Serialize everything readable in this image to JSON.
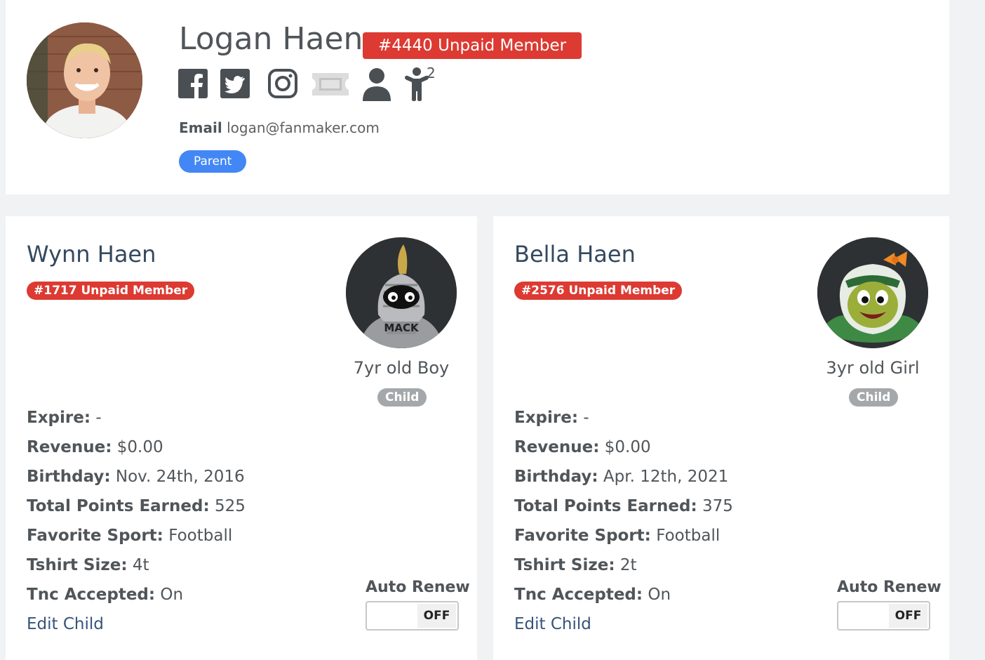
{
  "parent": {
    "name": "Logan Haen",
    "member_badge": "#4440 Unpaid Member",
    "kid_count": "2",
    "email_label": "Email",
    "email": "logan@fanmaker.com",
    "role": "Parent",
    "icons": [
      "facebook-icon",
      "twitter-icon",
      "instagram-icon",
      "ticket-icon",
      "person-icon",
      "child-icon"
    ]
  },
  "children": [
    {
      "name": "Wynn Haen",
      "member_badge": "#1717 Unpaid Member",
      "age": "7yr old Boy",
      "role": "Child",
      "fields": {
        "expire_label": "Expire:",
        "expire": "-",
        "revenue_label": "Revenue:",
        "revenue": "$0.00",
        "birthday_label": "Birthday:",
        "birthday": "Nov. 24th, 2016",
        "points_label": "Total Points Earned:",
        "points": "525",
        "sport_label": "Favorite Sport:",
        "sport": "Football",
        "tshirt_label": "Tshirt Size:",
        "tshirt": "4t",
        "tnc_label": "Tnc Accepted:",
        "tnc": "On"
      },
      "edit_label": "Edit Child",
      "auto_renew_label": "Auto Renew",
      "auto_renew_state": "OFF"
    },
    {
      "name": "Bella Haen",
      "member_badge": "#2576 Unpaid Member",
      "age": "3yr old Girl",
      "role": "Child",
      "fields": {
        "expire_label": "Expire:",
        "expire": "-",
        "revenue_label": "Revenue:",
        "revenue": "$0.00",
        "birthday_label": "Birthday:",
        "birthday": "Apr. 12th, 2021",
        "points_label": "Total Points Earned:",
        "points": "375",
        "sport_label": "Favorite Sport:",
        "sport": "Football",
        "tshirt_label": "Tshirt Size:",
        "tshirt": "2t",
        "tnc_label": "Tnc Accepted:",
        "tnc": "On"
      },
      "edit_label": "Edit Child",
      "auto_renew_label": "Auto Renew",
      "auto_renew_state": "OFF"
    }
  ],
  "colors": {
    "badge_red": "#dc3a32",
    "parent_pill": "#4287f5",
    "child_pill": "#a4a8ab",
    "name_blue": "#34495e",
    "link_blue": "#34557a"
  }
}
